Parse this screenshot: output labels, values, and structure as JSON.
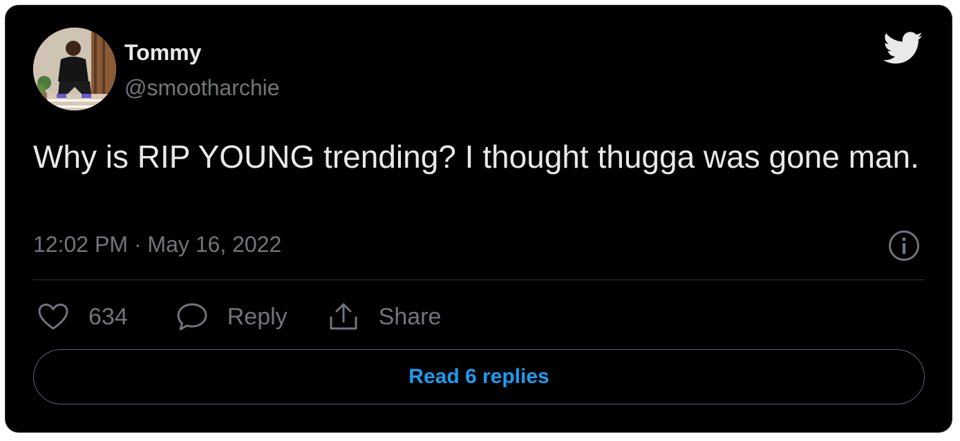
{
  "author": {
    "name": "Tommy",
    "handle": "@smootharchie"
  },
  "tweet": {
    "text": "Why is RIP YOUNG trending? I thought thugga was gone man.",
    "timestamp": "12:02 PM · May 16, 2022"
  },
  "actions": {
    "like_count": "634",
    "reply_label": "Reply",
    "share_label": "Share"
  },
  "read_replies_label": "Read 6 replies",
  "icons": {
    "brand": "twitter-bird-icon",
    "info": "info-icon",
    "like": "heart-icon",
    "reply": "reply-bubble-icon",
    "share": "share-icon"
  },
  "colors": {
    "background": "#000000",
    "text_primary": "#e7e9ea",
    "text_secondary": "#71767b",
    "accent": "#1d9bf0",
    "divider": "#2f3336"
  }
}
